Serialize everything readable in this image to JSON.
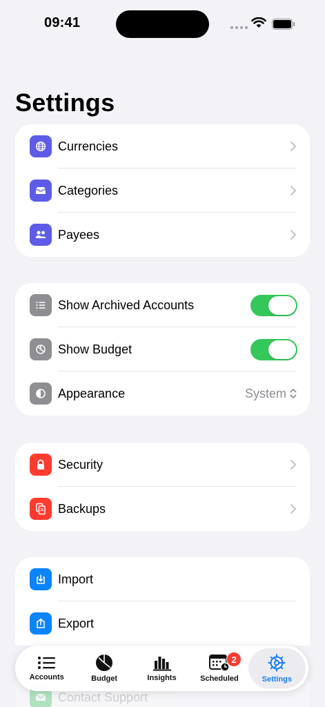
{
  "status_bar": {
    "time": "09:41"
  },
  "page": {
    "title": "Settings"
  },
  "groups": {
    "data": {
      "items": [
        {
          "label": "Currencies",
          "icon": "globe-icon",
          "color": "#5e5ce6"
        },
        {
          "label": "Categories",
          "icon": "tray-icon",
          "color": "#5e5ce6"
        },
        {
          "label": "Payees",
          "icon": "people-icon",
          "color": "#5e5ce6"
        }
      ]
    },
    "display": {
      "items": [
        {
          "label": "Show Archived Accounts",
          "icon": "list-icon",
          "color": "#8e8e93",
          "toggle_on": true
        },
        {
          "label": "Show Budget",
          "icon": "chart-pie-icon",
          "color": "#8e8e93",
          "toggle_on": true
        },
        {
          "label": "Appearance",
          "icon": "contrast-icon",
          "color": "#8e8e93",
          "value": "System"
        }
      ]
    },
    "safety": {
      "items": [
        {
          "label": "Security",
          "icon": "lock-icon",
          "color": "#ff3b30"
        },
        {
          "label": "Backups",
          "icon": "documents-icon",
          "color": "#ff3b30"
        }
      ]
    },
    "transfer": {
      "items": [
        {
          "label": "Import",
          "icon": "import-icon",
          "color": "#0a84ff"
        },
        {
          "label": "Export",
          "icon": "export-icon",
          "color": "#0a84ff"
        },
        {
          "label": "Contact Support",
          "icon": "mail-icon",
          "color": "#34c759"
        }
      ]
    }
  },
  "tab_bar": {
    "tabs": [
      {
        "label": "Accounts",
        "icon": "list-bullet-icon"
      },
      {
        "label": "Budget",
        "icon": "chart-pie-icon"
      },
      {
        "label": "Insights",
        "icon": "bar-chart-icon"
      },
      {
        "label": "Scheduled",
        "icon": "calendar-clock-icon",
        "badge": "2"
      },
      {
        "label": "Settings",
        "icon": "gear-icon",
        "active": true
      }
    ]
  },
  "colors": {
    "accent": "#1a7df6",
    "toggle_on": "#34c759",
    "background": "#f2f2f7"
  }
}
